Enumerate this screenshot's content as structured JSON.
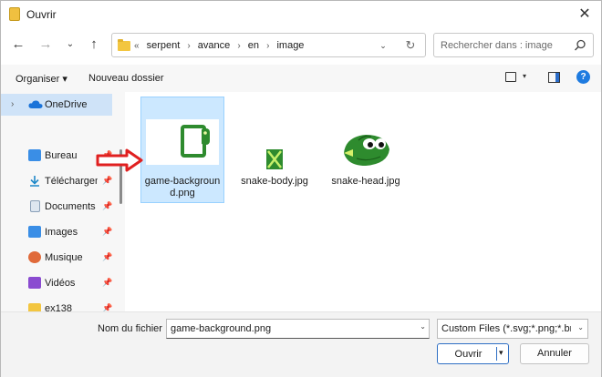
{
  "window": {
    "title": "Ouvrir",
    "close_symbol": "✕"
  },
  "nav": {
    "back": "←",
    "forward": "→",
    "recent": "⌄",
    "up": "↑",
    "breadcrumb_prefix": "«",
    "breadcrumbs": [
      "serpent",
      "avance",
      "en",
      "image"
    ],
    "breadcrumb_separator": "›",
    "search_placeholder": "Rechercher dans : image",
    "refresh_symbol": "↻",
    "dropdown_symbol": "⌄"
  },
  "toolbar": {
    "organize_label": "Organiser ▾",
    "new_folder_label": "Nouveau dossier",
    "view_dropdown": "▾",
    "help_label": "?"
  },
  "sidebar": {
    "items": [
      {
        "label": "OneDrive",
        "icon": "cloud-icon",
        "color": "#1a73d9",
        "selected": true
      },
      {
        "label": "Bureau",
        "icon": "desktop-icon",
        "color": "#3a8ee6",
        "pinned": true
      },
      {
        "label": "Téléchargem",
        "icon": "download-icon",
        "color": "#1e88c8",
        "pinned": true
      },
      {
        "label": "Documents",
        "icon": "documents-icon",
        "color": "#8aa0b8",
        "pinned": true
      },
      {
        "label": "Images",
        "icon": "images-icon",
        "color": "#3a8ee6",
        "pinned": true
      },
      {
        "label": "Musique",
        "icon": "music-icon",
        "color": "#e06a3a",
        "pinned": true
      },
      {
        "label": "Vidéos",
        "icon": "videos-icon",
        "color": "#8a4bd0",
        "pinned": true
      },
      {
        "label": "ex138",
        "icon": "folder-icon",
        "color": "#f3c640",
        "pinned": true
      }
    ],
    "pin_symbol": "📌",
    "chevron": "›"
  },
  "files": [
    {
      "name": "game-background.png",
      "selected": true
    },
    {
      "name": "snake-body.jpg",
      "selected": false
    },
    {
      "name": "snake-head.jpg",
      "selected": false
    }
  ],
  "bottom": {
    "filename_label": "Nom du fichier :",
    "filename_value": "game-background.png",
    "filetype_value": "Custom Files (*.svg;*.png;*.bmp;",
    "open_label": "Ouvrir",
    "cancel_label": "Annuler",
    "dropdown_symbol": "⌄"
  },
  "colors": {
    "accent": "#2f6fc4",
    "selection": "#cce8ff",
    "annotation_arrow": "#e02020",
    "snake_green": "#2e8b2e"
  }
}
